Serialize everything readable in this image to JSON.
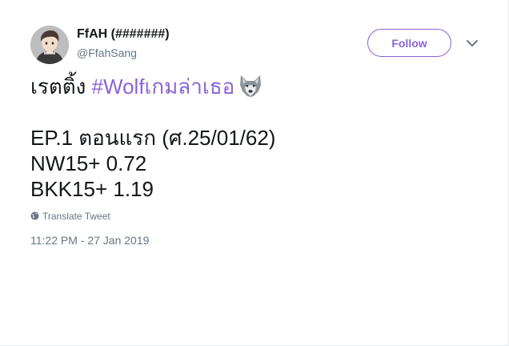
{
  "user": {
    "display_name": "FfAH (#######)",
    "handle": "@FfahSang",
    "avatar_icon": "profile-photo-avatar"
  },
  "follow_button": {
    "label": "Follow",
    "color": "#8b63d6"
  },
  "more_options": {
    "icon": "chevron-down-icon"
  },
  "tweet": {
    "prefix": "เรตติ้ง ",
    "hashtag": "#Wolfเกมล่าเธอ",
    "emoji": "wolf-face-emoji",
    "lines": [
      "EP.1 ตอนแรก (ศ.25/01/62)",
      "NW15+ 0.72",
      "BKK15+ 1.19"
    ]
  },
  "translate": {
    "label": "Translate Tweet",
    "icon": "globe-icon"
  },
  "timestamp": "11:22 PM - 27 Jan 2019",
  "colors": {
    "accent": "#8b63d6",
    "text": "#14171a",
    "secondary": "#657786"
  }
}
